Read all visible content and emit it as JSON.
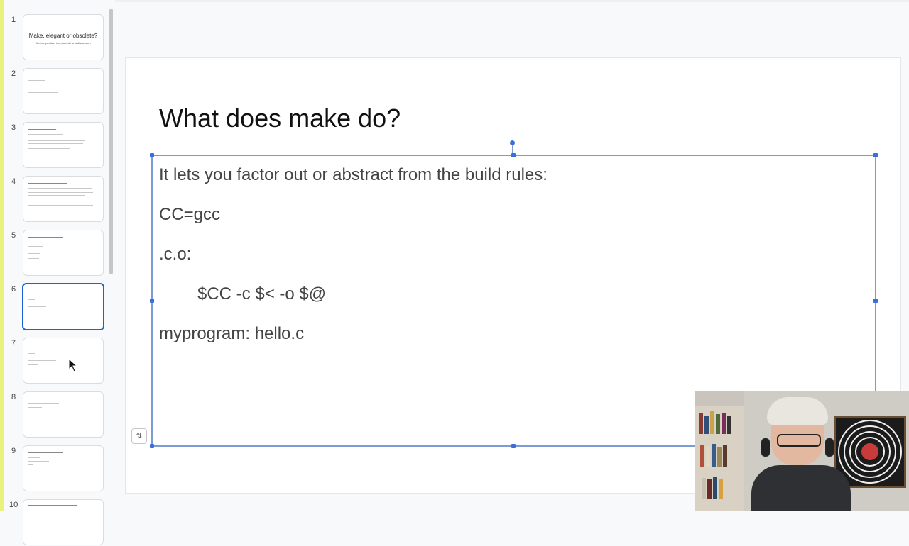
{
  "filmstrip": {
    "slides": [
      {
        "number": "1",
        "title": "Make, elegant or obsolete?",
        "subtitle": "A retrospective, tour, tutorial and discussion"
      },
      {
        "number": "2"
      },
      {
        "number": "3"
      },
      {
        "number": "4"
      },
      {
        "number": "5"
      },
      {
        "number": "6"
      },
      {
        "number": "7"
      },
      {
        "number": "8"
      },
      {
        "number": "9"
      },
      {
        "number": "10"
      }
    ],
    "selected_index": 6
  },
  "slide": {
    "title": "What does make do?",
    "body": [
      "It lets you factor out or abstract from the build rules:",
      "CC=gcc",
      ".c.o:",
      "$CC -c $< -o $@",
      "myprogram: hello.c"
    ]
  },
  "notes_toggle": {
    "icon": "collapse-arrows-icon"
  },
  "colors": {
    "accent": "#1a62d6",
    "selection_border": "#7c9bd6"
  }
}
